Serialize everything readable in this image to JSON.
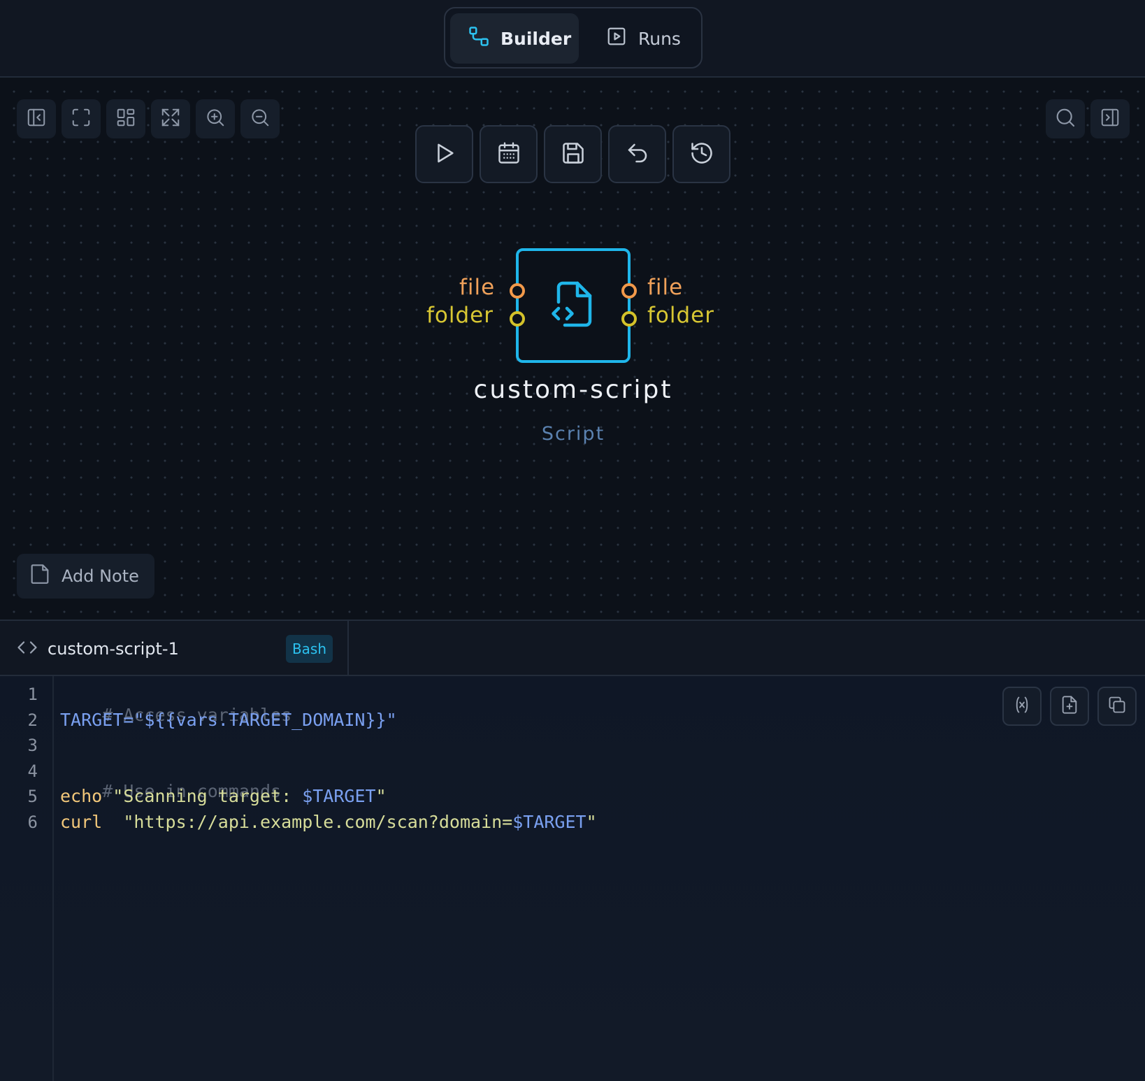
{
  "header": {
    "tabs": [
      {
        "label": "Builder",
        "icon": "workflow-icon",
        "active": true
      },
      {
        "label": "Runs",
        "icon": "play-square-icon",
        "active": false
      }
    ]
  },
  "canvas_toolbar": {
    "left_tools": [
      "sidebar-collapse-icon",
      "fullscreen-icon",
      "layout-grid-icon",
      "fit-view-icon",
      "zoom-in-icon",
      "zoom-out-icon"
    ],
    "right_tools": [
      "search-icon",
      "panel-right-icon"
    ],
    "exec_tools": [
      "play-icon",
      "calendar-icon",
      "save-icon",
      "undo-icon",
      "history-icon"
    ]
  },
  "node": {
    "title": "custom-script",
    "type": "Script",
    "inputs": [
      {
        "label": "file",
        "color": "#f2994a"
      },
      {
        "label": "folder",
        "color": "#d4c22a"
      }
    ],
    "outputs": [
      {
        "label": "file",
        "color": "#f2994a"
      },
      {
        "label": "folder",
        "color": "#d4c22a"
      }
    ],
    "accent": "#1fb6ea"
  },
  "add_note": {
    "label": "Add Note"
  },
  "editor": {
    "tab_name": "custom-script-1",
    "language": "Bash",
    "line_numbers": [
      "1",
      "2",
      "3",
      "4",
      "5",
      "6"
    ],
    "lines": {
      "l1": {
        "comment": "# Access variables"
      },
      "l2": {
        "a": "TARGET=",
        "b": "\"${{vars.TARGET_DOMAIN}}\""
      },
      "l4": {
        "comment": "# Use in commands"
      },
      "l5": {
        "kw": "echo",
        "str": " \"Scanning target: ",
        "var": "$TARGET",
        "end": "\""
      },
      "l6": {
        "kw": "curl",
        "str": "  \"https://api.example.com/scan?domain=",
        "var": "$TARGET",
        "end": "\""
      }
    },
    "tools": [
      "variable-icon",
      "file-import-icon",
      "copy-icon"
    ]
  }
}
